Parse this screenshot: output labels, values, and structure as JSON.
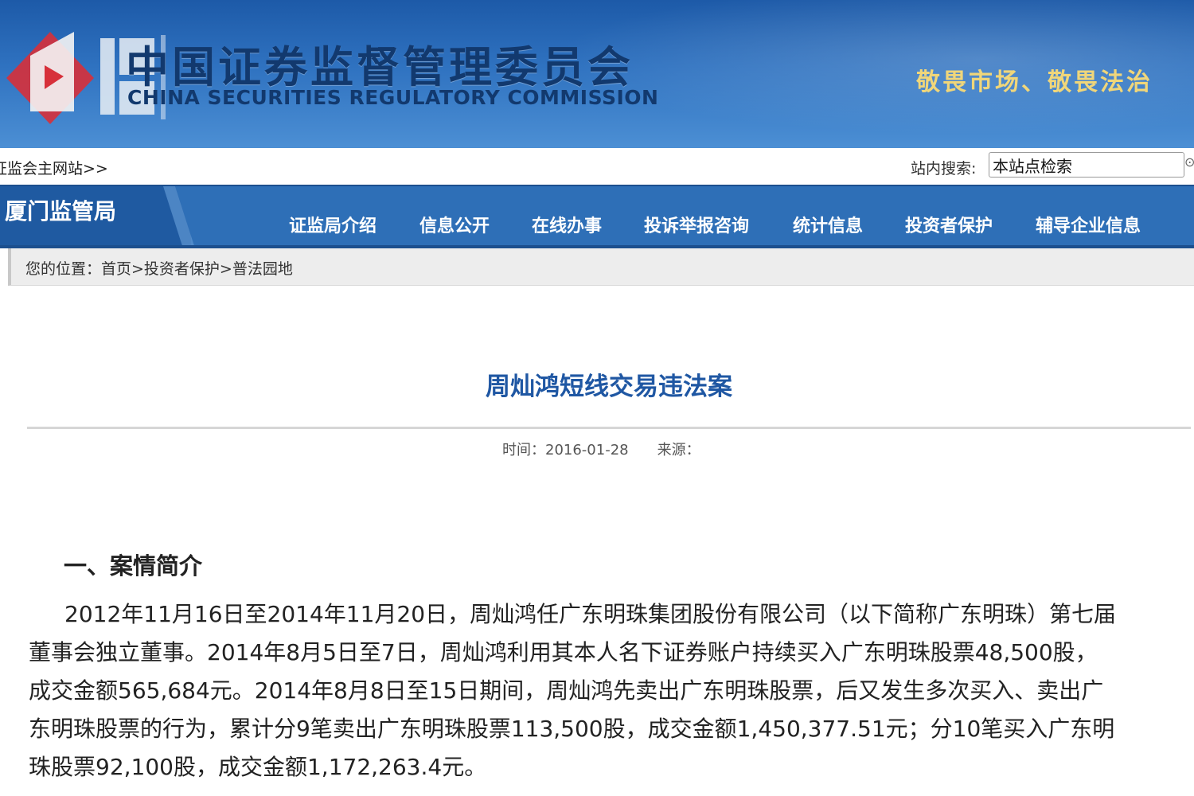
{
  "banner": {
    "title_cn": "中国证券监督管理委员会",
    "title_en": "CHINA SECURITIES REGULATORY COMMISSION",
    "slogan": "敬畏市场、敬畏法治"
  },
  "topbar": {
    "main_site_link": "证监会主网站>>",
    "search_label": "站内搜索:",
    "search_value": "本站点检索"
  },
  "nav": {
    "brand": "厦门监管局",
    "items": [
      "证监局介绍",
      "信息公开",
      "在线办事",
      "投诉举报咨询",
      "统计信息",
      "投资者保护",
      "辅导企业信息"
    ]
  },
  "breadcrumb": "您的位置：首页>投资者保护>普法园地",
  "article": {
    "title": "周灿鸿短线交易违法案",
    "time": "时间：2016-01-28",
    "source": "来源：",
    "section1_heading": "一、案情简介",
    "lines": [
      "2012年11月16日至2014年11月20日，周灿鸿任广东明珠集团股份有限公司（以下简称广东明珠）第七届",
      "董事会独立董事。2014年8月5日至7日，周灿鸿利用其本人名下证券账户持续买入广东明珠股票48,500股，",
      "成交金额565,684元。2014年8月8日至15日期间，周灿鸿先卖出广东明珠股票，后又发生多次买入、卖出广",
      "东明珠股票的行为，累计分9笔卖出广东明珠股票113,500股，成交金额1,450,377.51元；分10笔买入广东明",
      "珠股票92,100股，成交金额1,172,263.4元。"
    ]
  },
  "colors": {
    "banner_blue": "#2f72c0",
    "nav_blue": "#2e6fb7",
    "title_blue": "#1f57a3",
    "slogan_gold": "#f0d67a"
  }
}
